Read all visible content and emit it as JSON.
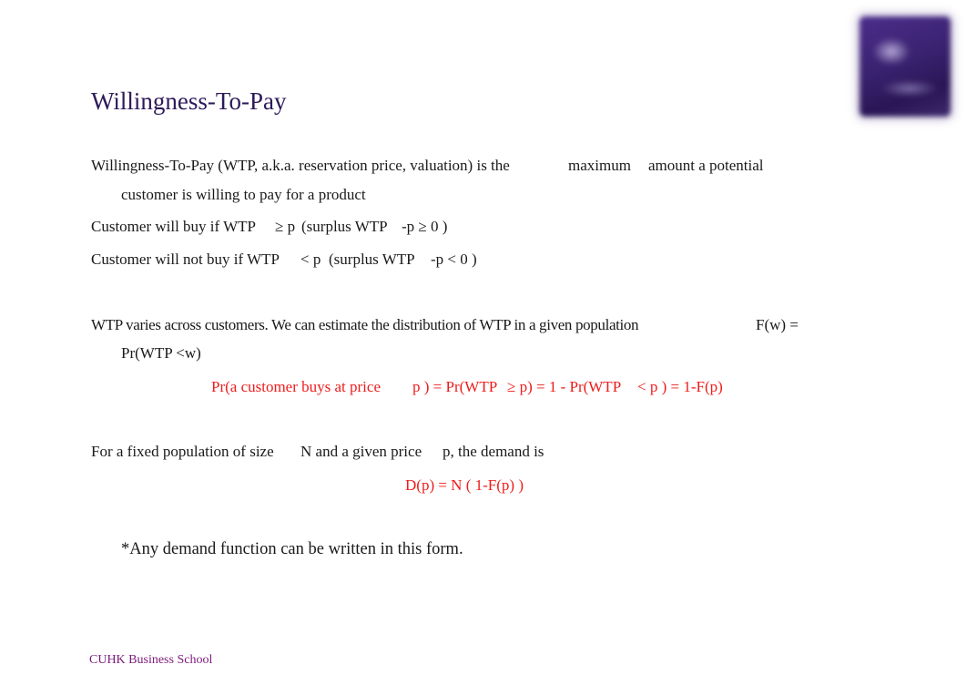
{
  "slide": {
    "title": "Willingness-To-Pay",
    "logo": {
      "name": "cuhk-business-school-logo",
      "color": "#3a2270"
    },
    "paragraphs": {
      "definition_line1_a": "Willingness-To-Pay (WTP, a.k.a. reservation price, valuation) is the",
      "definition_line1_b": "maximum",
      "definition_line1_c": "amount a potential",
      "definition_line2": "customer is willing to pay for a product",
      "buy_a": "Customer will buy if WTP",
      "buy_b": "≥ p",
      "buy_c": "(surplus WTP",
      "buy_d": "-p ≥ 0 )",
      "notbuy_a": "Customer will not buy if WTP",
      "notbuy_b": "< p",
      "notbuy_c": "(surplus WTP",
      "notbuy_d": "-p < 0 )",
      "dist_line1_a": "WTP varies across customers. We can estimate the distribution of WTP in a given population",
      "dist_line1_b": "F(w) =",
      "dist_line2": "Pr(WTP <w)",
      "formula1_a": "Pr(a customer buys at price",
      "formula1_b": "p ) = Pr(WTP",
      "formula1_c": "≥ p) = 1 - Pr(WTP",
      "formula1_d": "< p ) =  1-F(p)",
      "demand_a": "For a fixed population of size",
      "demand_b": "N and a given price",
      "demand_c": "p, the demand is",
      "formula2": "D(p) = N ( 1-F(p) )",
      "note": "*Any demand function can be written in this form."
    },
    "footer": "CUHK Business School",
    "colors": {
      "title": "#2d1a5a",
      "body": "#1a1a1a",
      "formula": "#ee1c1c",
      "footer": "#7b1a7b"
    }
  }
}
